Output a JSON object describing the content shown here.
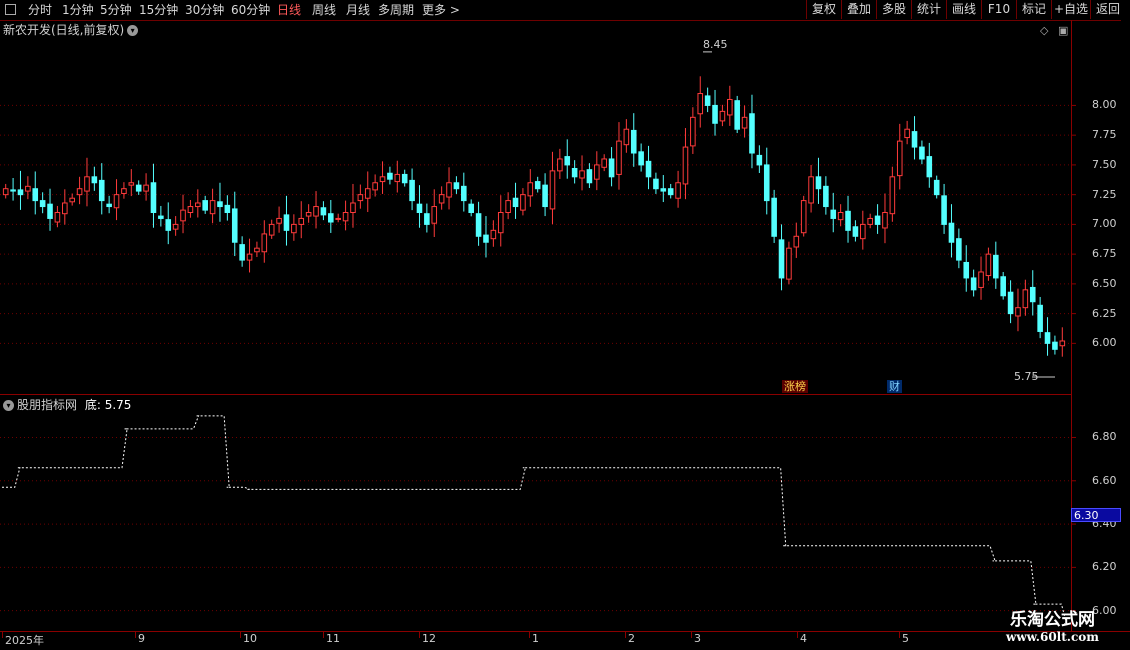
{
  "toolbar": {
    "periods": [
      "分时",
      "1分钟",
      "5分钟",
      "15分钟",
      "30分钟",
      "60分钟",
      "日线",
      "周线",
      "月线",
      "多周期",
      "更多 >"
    ],
    "active_period": "日线",
    "buttons": [
      "复权",
      "叠加",
      "多股",
      "统计",
      "画线",
      "F10",
      "标记",
      "+自选",
      "返回"
    ]
  },
  "chart": {
    "title": "新农开发(日线,前复权)",
    "high_label": "8.45",
    "low_label": "5.75",
    "events": [
      {
        "label": "涨榜",
        "color": "#ff4040"
      },
      {
        "label": "财",
        "color": "#3399ff"
      }
    ],
    "y_axis": [
      "8.00",
      "7.75",
      "7.50",
      "7.25",
      "7.00",
      "6.75",
      "6.50",
      "6.25",
      "6.00"
    ],
    "colors": {
      "up": "#ff3b3b",
      "down": "#54ffff",
      "grid": "#6e0000",
      "axis": "#8a0000"
    }
  },
  "indicator": {
    "name": "股朋指标网",
    "series_label": "底: 5.75",
    "current_value": "6.30",
    "y_axis": [
      "6.80",
      "6.60",
      "6.40",
      "6.20",
      "6.00"
    ]
  },
  "dates": [
    "2025年",
    "9",
    "10",
    "11",
    "12",
    "1",
    "2",
    "3",
    "4",
    "5"
  ],
  "watermark": {
    "name": "乐淘公式网",
    "url": "www.60lt.com"
  },
  "chart_data": {
    "type": "candlestick",
    "title": "新农开发(日线,前复权)",
    "ylim": [
      5.65,
      8.55
    ],
    "levels": [
      8.0,
      7.75,
      7.5,
      7.25,
      7.0,
      6.75,
      6.5,
      6.25,
      6.0
    ],
    "x_period_labels": [
      "2025年",
      "9",
      "10",
      "11",
      "12",
      "1",
      "2",
      "3",
      "4",
      "5"
    ],
    "close": [
      7.3,
      7.28,
      7.25,
      7.32,
      7.2,
      7.15,
      7.05,
      7.1,
      7.18,
      7.22,
      7.3,
      7.4,
      7.35,
      7.2,
      7.15,
      7.25,
      7.3,
      7.35,
      7.28,
      7.33,
      7.1,
      7.05,
      6.95,
      7.0,
      7.12,
      7.15,
      7.18,
      7.12,
      7.2,
      7.15,
      7.1,
      6.85,
      6.7,
      6.75,
      6.8,
      6.92,
      7.0,
      7.05,
      6.95,
      7.0,
      7.05,
      7.1,
      7.15,
      7.08,
      7.02,
      7.05,
      7.1,
      7.18,
      7.25,
      7.3,
      7.35,
      7.4,
      7.38,
      7.42,
      7.35,
      7.2,
      7.1,
      7.0,
      7.15,
      7.25,
      7.35,
      7.3,
      7.2,
      7.1,
      6.9,
      6.85,
      6.95,
      7.1,
      7.2,
      7.15,
      7.25,
      7.35,
      7.3,
      7.15,
      7.45,
      7.55,
      7.5,
      7.4,
      7.45,
      7.35,
      7.5,
      7.55,
      7.4,
      7.7,
      7.8,
      7.6,
      7.5,
      7.4,
      7.3,
      7.28,
      7.25,
      7.35,
      7.65,
      7.9,
      8.1,
      8.0,
      7.85,
      7.95,
      8.05,
      7.8,
      7.9,
      7.6,
      7.5,
      7.2,
      6.9,
      6.55,
      6.8,
      6.9,
      7.2,
      7.4,
      7.3,
      7.15,
      7.05,
      7.1,
      6.95,
      6.9,
      7.0,
      7.05,
      7.0,
      7.1,
      7.4,
      7.7,
      7.8,
      7.65,
      7.55,
      7.4,
      7.25,
      7.0,
      6.85,
      6.7,
      6.55,
      6.45,
      6.6,
      6.75,
      6.55,
      6.4,
      6.25,
      6.3,
      6.45,
      6.35,
      6.1,
      6.0,
      5.95,
      6.02
    ],
    "indicator_type": "step-line",
    "indicator_ylim": [
      5.92,
      6.95
    ],
    "indicator_levels": [
      6.8,
      6.6,
      6.4,
      6.2,
      6.0
    ],
    "indicator_values": [
      6.57,
      6.57,
      6.57,
      6.66,
      6.66,
      6.66,
      6.66,
      6.66,
      6.66,
      6.66,
      6.66,
      6.66,
      6.66,
      6.66,
      6.66,
      6.66,
      6.66,
      6.66,
      6.66,
      6.66,
      6.66,
      6.66,
      6.66,
      6.66,
      6.84,
      6.84,
      6.84,
      6.84,
      6.84,
      6.84,
      6.84,
      6.84,
      6.84,
      6.84,
      6.84,
      6.84,
      6.84,
      6.84,
      6.9,
      6.9,
      6.9,
      6.9,
      6.9,
      6.9,
      6.57,
      6.57,
      6.57,
      6.57,
      6.56,
      6.56,
      6.56,
      6.56,
      6.56,
      6.56,
      6.56,
      6.56,
      6.56,
      6.56,
      6.56,
      6.56,
      6.56,
      6.56,
      6.56,
      6.56,
      6.56,
      6.56,
      6.56,
      6.56,
      6.56,
      6.56,
      6.56,
      6.56,
      6.56,
      6.56,
      6.56,
      6.56,
      6.56,
      6.56,
      6.56,
      6.56,
      6.56,
      6.56,
      6.56,
      6.56,
      6.56,
      6.56,
      6.56,
      6.56,
      6.56,
      6.56,
      6.56,
      6.56,
      6.56,
      6.56,
      6.56,
      6.56,
      6.56,
      6.56,
      6.56,
      6.56,
      6.56,
      6.56,
      6.66,
      6.66,
      6.66,
      6.66,
      6.66,
      6.66,
      6.66,
      6.66,
      6.66,
      6.66,
      6.66,
      6.66,
      6.66,
      6.66,
      6.66,
      6.66,
      6.66,
      6.66,
      6.66,
      6.66,
      6.66,
      6.66,
      6.66,
      6.66,
      6.66,
      6.66,
      6.66,
      6.66,
      6.66,
      6.66,
      6.66,
      6.66,
      6.66,
      6.66,
      6.66,
      6.66,
      6.66,
      6.66,
      6.66,
      6.66,
      6.66,
      6.66,
      6.66,
      6.66,
      6.66,
      6.66,
      6.66,
      6.66,
      6.66,
      6.66,
      6.66,
      6.3,
      6.3,
      6.3,
      6.3,
      6.3,
      6.3,
      6.3,
      6.3,
      6.3,
      6.3,
      6.3,
      6.3,
      6.3,
      6.3,
      6.3,
      6.3,
      6.3,
      6.3,
      6.3,
      6.3,
      6.3,
      6.3,
      6.3,
      6.3,
      6.3,
      6.3,
      6.3,
      6.3,
      6.3,
      6.3,
      6.3,
      6.3,
      6.3,
      6.3,
      6.3,
      6.3,
      6.3,
      6.3,
      6.3,
      6.3,
      6.3,
      6.23,
      6.23,
      6.23,
      6.23,
      6.23,
      6.23,
      6.23,
      6.23,
      6.03,
      6.03,
      6.03,
      6.03,
      6.03,
      6.03,
      5.94
    ]
  }
}
